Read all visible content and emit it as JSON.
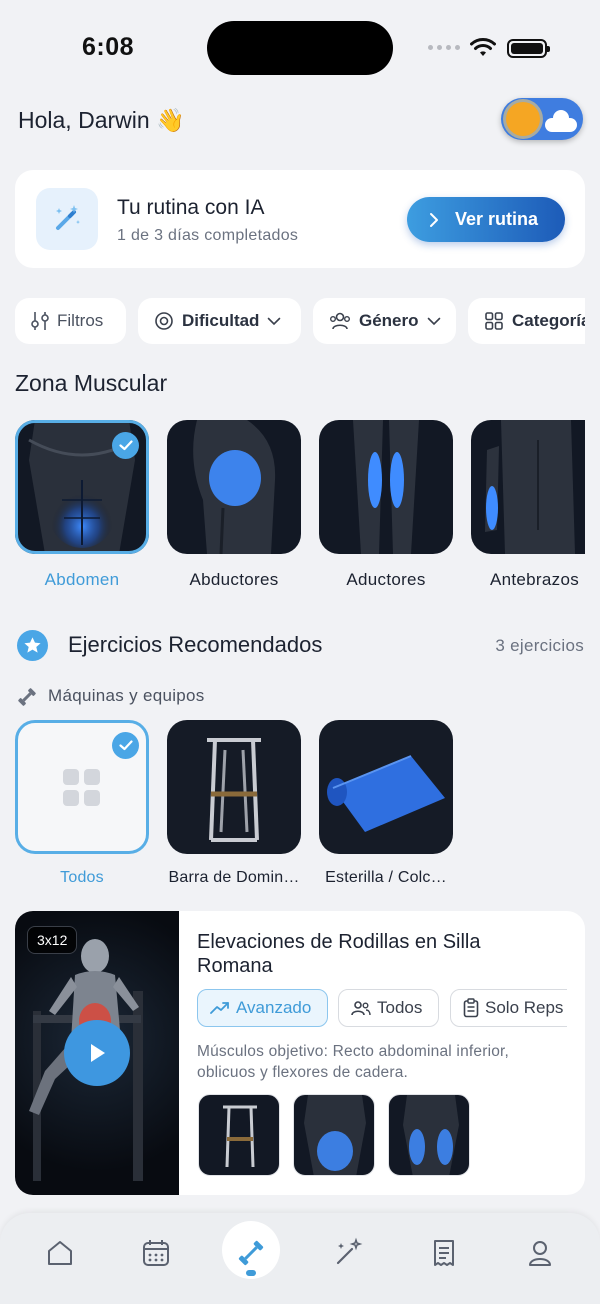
{
  "status_bar": {
    "time": "6:08"
  },
  "header": {
    "greeting": "Hola, Darwin 👋"
  },
  "routine": {
    "title": "Tu rutina con IA",
    "subtitle": "1 de 3 días completados",
    "button_label": "Ver rutina"
  },
  "filters": [
    {
      "label": "Filtros",
      "icon": "sliders-icon"
    },
    {
      "label": "Dificultad",
      "icon": "gauge-icon"
    },
    {
      "label": "Género",
      "icon": "users-icon"
    },
    {
      "label": "Categoría",
      "icon": "grid-icon"
    }
  ],
  "muscle_zone": {
    "title": "Zona Muscular",
    "items": [
      {
        "label": "Abdomen",
        "selected": true
      },
      {
        "label": "Abductores",
        "selected": false
      },
      {
        "label": "Aductores",
        "selected": false
      },
      {
        "label": "Antebrazos",
        "selected": false
      }
    ]
  },
  "recommended": {
    "title": "Ejercicios Recomendados",
    "count": "3 ejercicios",
    "equipment_label": "Máquinas y equipos",
    "equipment": [
      {
        "label": "Todos",
        "selected": true
      },
      {
        "label": "Barra de Domin…",
        "selected": false
      },
      {
        "label": "Esterilla / Colc…",
        "selected": false
      }
    ]
  },
  "exercise": {
    "badge": "3x12",
    "title": "Elevaciones de Rodillas en Silla Romana",
    "tags": [
      {
        "label": "Avanzado",
        "icon": "trend-up-icon",
        "active": true
      },
      {
        "label": "Todos",
        "icon": "users-icon",
        "active": false
      },
      {
        "label": "Solo Reps",
        "icon": "clipboard-icon",
        "active": false
      }
    ],
    "description": "Músculos objetivo: Recto abdominal inferior, oblicuos y flexores de cadera."
  },
  "bottom_nav": [
    {
      "name": "home",
      "icon": "home-icon"
    },
    {
      "name": "calendar",
      "icon": "calendar-icon"
    },
    {
      "name": "workouts",
      "icon": "dumbbell-icon",
      "active": true
    },
    {
      "name": "ai",
      "icon": "magic-wand-icon"
    },
    {
      "name": "notes",
      "icon": "receipt-icon"
    },
    {
      "name": "profile",
      "icon": "user-icon"
    }
  ],
  "colors": {
    "accent": "#3f9bd8",
    "background": "#f1f2f5",
    "card": "#ffffff"
  }
}
